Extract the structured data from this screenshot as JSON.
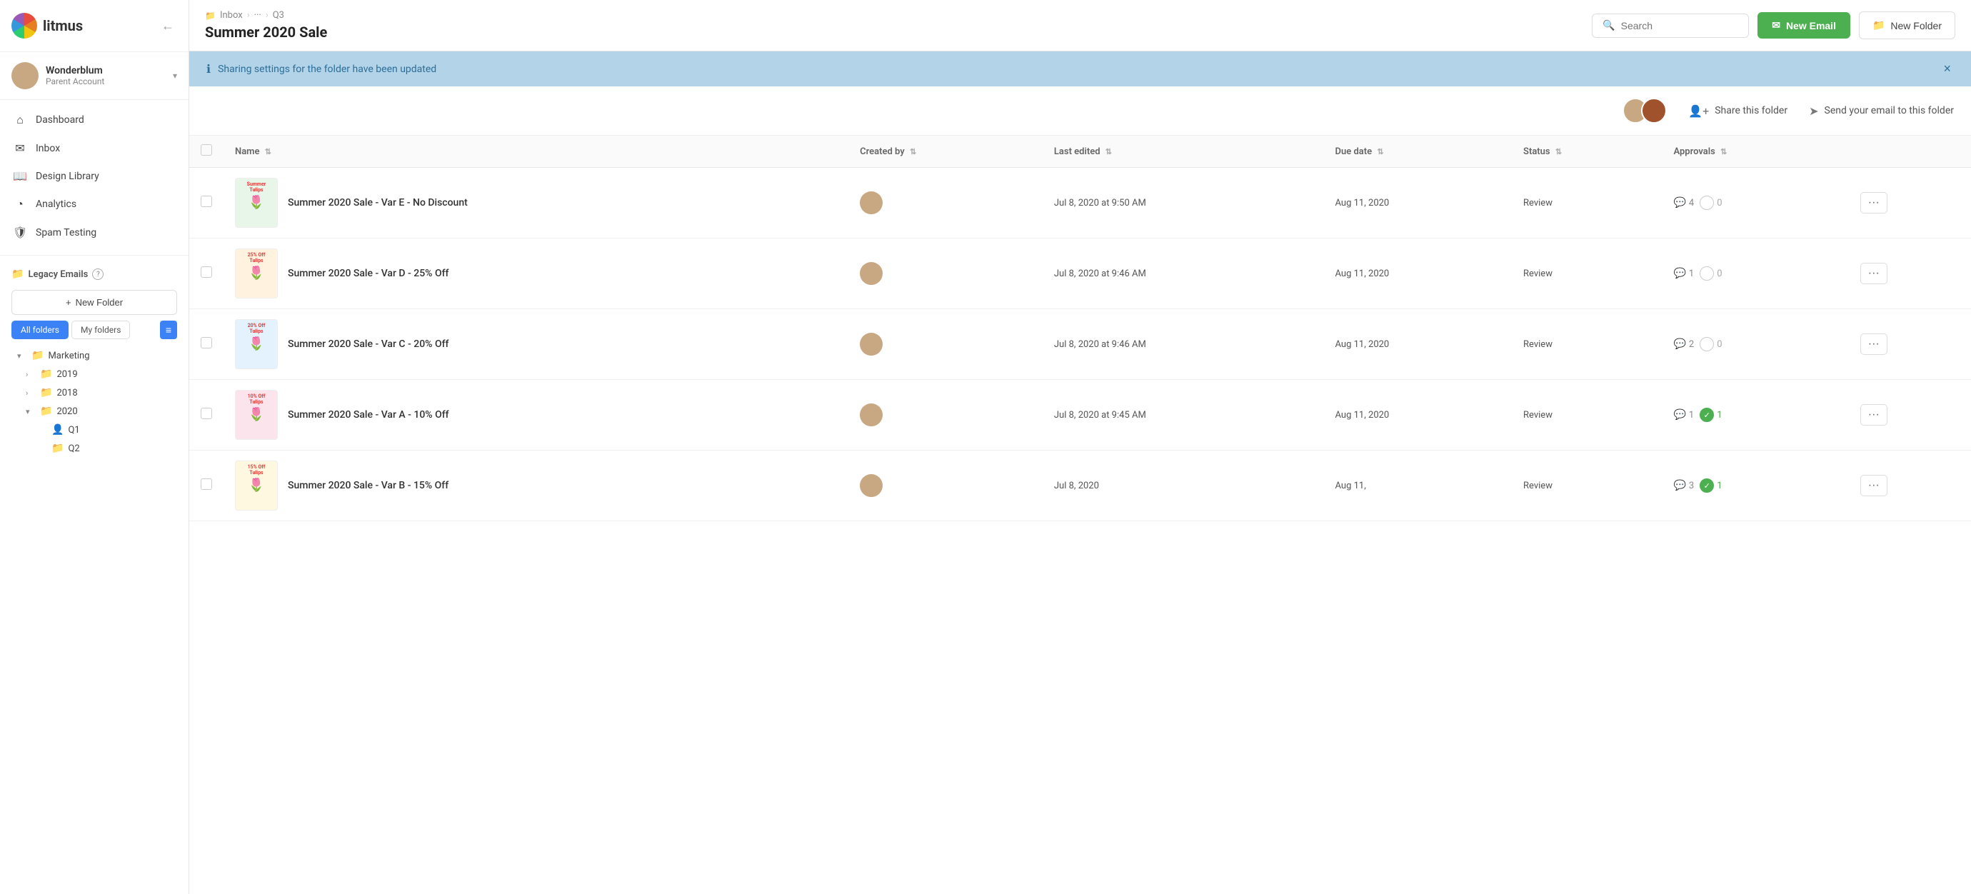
{
  "app": {
    "logo_text": "litmus"
  },
  "sidebar": {
    "user": {
      "name": "Wonderblum",
      "account": "Parent Account"
    },
    "nav_items": [
      {
        "id": "dashboard",
        "label": "Dashboard",
        "icon": "⌂"
      },
      {
        "id": "inbox",
        "label": "Inbox",
        "icon": "✉"
      },
      {
        "id": "design-library",
        "label": "Design Library",
        "icon": "📖"
      },
      {
        "id": "analytics",
        "label": "Analytics",
        "icon": "◔"
      },
      {
        "id": "spam-testing",
        "label": "Spam Testing",
        "icon": "🛡"
      }
    ],
    "legacy_emails": {
      "label": "Legacy Emails"
    },
    "folder_tabs": [
      {
        "label": "All folders",
        "active": true
      },
      {
        "label": "My folders",
        "active": false
      }
    ],
    "folders": [
      {
        "id": "marketing",
        "label": "Marketing",
        "indent": 0,
        "expanded": true,
        "icon": "📁"
      },
      {
        "id": "2019",
        "label": "2019",
        "indent": 1,
        "expanded": false,
        "icon": "📁"
      },
      {
        "id": "2018",
        "label": "2018",
        "indent": 1,
        "expanded": false,
        "icon": "📁"
      },
      {
        "id": "2020",
        "label": "2020",
        "indent": 1,
        "expanded": true,
        "icon": "📁"
      },
      {
        "id": "q1",
        "label": "Q1",
        "indent": 2,
        "icon": "👤",
        "is_shared": true
      },
      {
        "id": "q2",
        "label": "Q2",
        "indent": 2,
        "icon": "📁"
      }
    ]
  },
  "header": {
    "breadcrumb": [
      {
        "label": "Inbox",
        "icon": "📁"
      },
      {
        "label": "···"
      },
      {
        "label": "Q3"
      }
    ],
    "title": "Summer 2020 Sale",
    "search_placeholder": "Search",
    "new_email_label": "New Email",
    "new_folder_label": "New Folder"
  },
  "notification": {
    "message": "Sharing settings for the folder have been updated"
  },
  "sharing": {
    "share_folder_label": "Share this folder",
    "send_email_label": "Send your email to this folder"
  },
  "table": {
    "columns": [
      {
        "id": "name",
        "label": "Name"
      },
      {
        "id": "created_by",
        "label": "Created by"
      },
      {
        "id": "last_edited",
        "label": "Last edited"
      },
      {
        "id": "due_date",
        "label": "Due date"
      },
      {
        "id": "status",
        "label": "Status"
      },
      {
        "id": "approvals",
        "label": "Approvals"
      }
    ],
    "rows": [
      {
        "id": "var-e",
        "name": "Summer 2020 Sale - Var E - No Discount",
        "thumb_label": "Summer Tulips",
        "thumb_class": "thumb-var-e",
        "last_edited": "Jul 8, 2020 at 9:50 AM",
        "due_date": "Aug 11, 2020",
        "status": "Review",
        "comments": 4,
        "approvals": 0,
        "approved": false
      },
      {
        "id": "var-d",
        "name": "Summer 2020 Sale - Var D - 25% Off",
        "thumb_label": "25% Off Tulips",
        "thumb_class": "thumb-var-d",
        "last_edited": "Jul 8, 2020 at 9:46 AM",
        "due_date": "Aug 11, 2020",
        "status": "Review",
        "comments": 1,
        "approvals": 0,
        "approved": false
      },
      {
        "id": "var-c",
        "name": "Summer 2020 Sale - Var C - 20% Off",
        "thumb_label": "20% Off Tulips",
        "thumb_class": "thumb-var-c",
        "last_edited": "Jul 8, 2020 at 9:46 AM",
        "due_date": "Aug 11, 2020",
        "status": "Review",
        "comments": 2,
        "approvals": 0,
        "approved": false
      },
      {
        "id": "var-a",
        "name": "Summer 2020 Sale - Var A - 10% Off",
        "thumb_label": "10% Off Tulips",
        "thumb_class": "thumb-var-a",
        "last_edited": "Jul 8, 2020 at 9:45 AM",
        "due_date": "Aug 11, 2020",
        "status": "Review",
        "comments": 1,
        "approvals": 1,
        "approved": true
      },
      {
        "id": "var-b",
        "name": "Summer 2020 Sale - Var B - 15% Off",
        "thumb_label": "15% Off Tulips",
        "thumb_class": "thumb-var-b",
        "last_edited": "Jul 8, 2020",
        "due_date": "Aug 11,",
        "status": "Review",
        "comments": 3,
        "approvals": 1,
        "approved": true
      }
    ]
  },
  "icons": {
    "search": "🔍",
    "envelope": "✉",
    "folder_plus": "📁",
    "chevron_down": "▾",
    "chevron_right": "›",
    "sort": "⇅",
    "comment": "💬",
    "check": "✓",
    "close": "×",
    "info": "ℹ",
    "share": "👤",
    "send": "➤",
    "more": "···",
    "back": "←",
    "list": "≡"
  }
}
